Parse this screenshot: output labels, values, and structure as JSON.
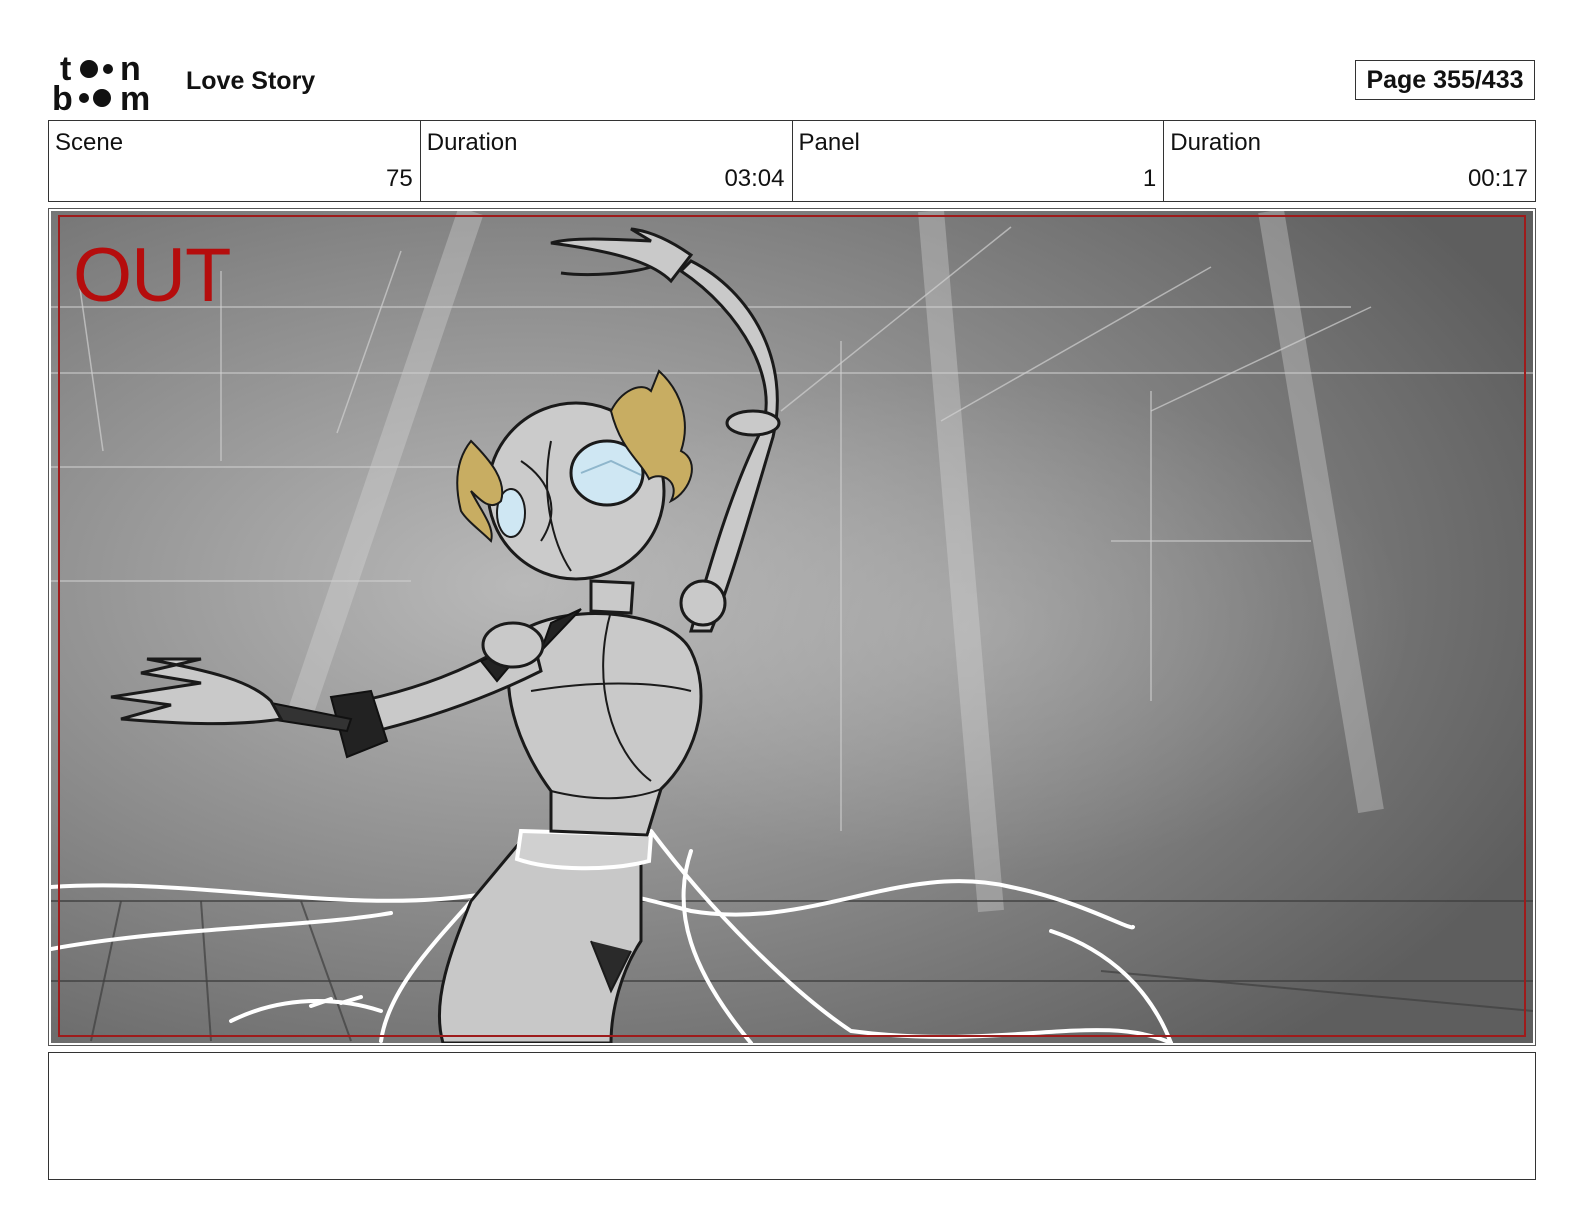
{
  "logo": {
    "text_top": "toon",
    "text_bottom": "boom",
    "icon": "toon-boom-logo"
  },
  "header": {
    "project_title": "Love Story",
    "page_label": "Page 355/433"
  },
  "info": [
    {
      "label": "Scene",
      "value": "75"
    },
    {
      "label": "Duration",
      "value": "03:04"
    },
    {
      "label": "Panel",
      "value": "1"
    },
    {
      "label": "Duration",
      "value": "00:17"
    }
  ],
  "panel": {
    "overlay_text": "OUT",
    "colors": {
      "overlay": "#b50d0d",
      "hair": "#c8ad62",
      "eye": "#cfe7f3",
      "background": "#7a7a7a"
    }
  },
  "notes": {
    "text": ""
  }
}
